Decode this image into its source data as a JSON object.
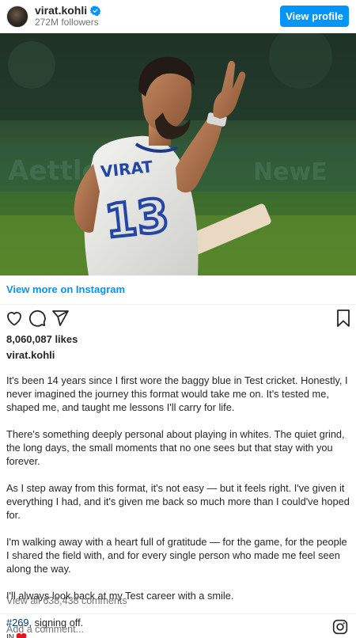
{
  "header": {
    "username": "virat.kohli",
    "followers": "272M followers",
    "view_profile_label": "View profile"
  },
  "post": {
    "view_more_label": "View more on Instagram",
    "likes": "8,060,087 likes",
    "caption_username": "virat.kohli",
    "caption_paragraphs": [
      "It's been 14 years since I first wore the baggy blue in Test cricket. Honestly, I never imagined the journey this format would take me on. It's tested me, shaped me, and taught me lessons I'll carry for life.",
      "There's something deeply personal about playing in whites. The quiet grind, the long days, the small moments that no one sees but that stay with you forever.",
      "As I step away from this format, it's not easy — but it feels right. I've given it everything I had, and it's given me back so much more than I could've hoped for.",
      "I'm walking away with a heart full of gratitude — for the game, for the people I shared the field with, and for every single person who made me feel seen along the way.",
      "I'll always look back at my Test career with a smile."
    ],
    "hashtag": "#269",
    "sign_off": ", signing off.",
    "in_text": "IN",
    "view_comments": "View all 638,438 comments",
    "add_comment_placeholder": "Add a comment...",
    "jersey_name": "VIRAT",
    "jersey_number": "13"
  },
  "colors": {
    "accent": "#0095f6",
    "hashtag": "#00376b",
    "heart": "#e8111f"
  },
  "icons": [
    "verified-badge-icon",
    "heart-icon",
    "comment-icon",
    "share-icon",
    "bookmark-icon",
    "red-heart-icon",
    "instagram-icon"
  ]
}
